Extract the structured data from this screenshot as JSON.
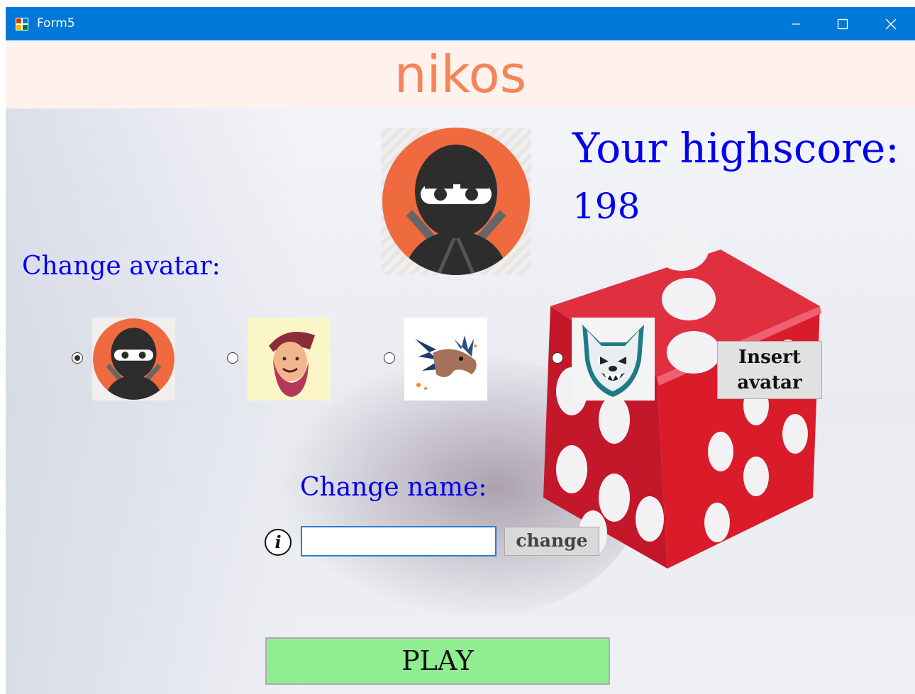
{
  "window": {
    "title": "Form5",
    "controls": [
      "minimize-icon",
      "maximize-icon",
      "close-icon"
    ],
    "accent": "#0078d7"
  },
  "header": {
    "username": "nikos",
    "username_color": "#f5845a",
    "background": "#fff2ec"
  },
  "highscore": {
    "label": "Your highscore:",
    "value": "198",
    "color": "#0000ee"
  },
  "avatars": {
    "label": "Change avatar:",
    "selected_index": 0,
    "options": [
      {
        "icon": "ninja-avatar-icon"
      },
      {
        "icon": "bearded-cap-man-avatar-icon"
      },
      {
        "icon": "dragon-avatar-icon"
      },
      {
        "icon": "wolf-avatar-icon"
      }
    ],
    "insert_button": "Insert\navatar"
  },
  "name": {
    "label": "Change name:",
    "input_value": "",
    "change_button": "change",
    "info_icon": "info-icon"
  },
  "play_button": "PLAY",
  "colors": {
    "label_blue": "#0000ee",
    "play_green": "#90ee90",
    "button_gray": "#e1e1e1",
    "dice_red": "#d91b2a"
  }
}
